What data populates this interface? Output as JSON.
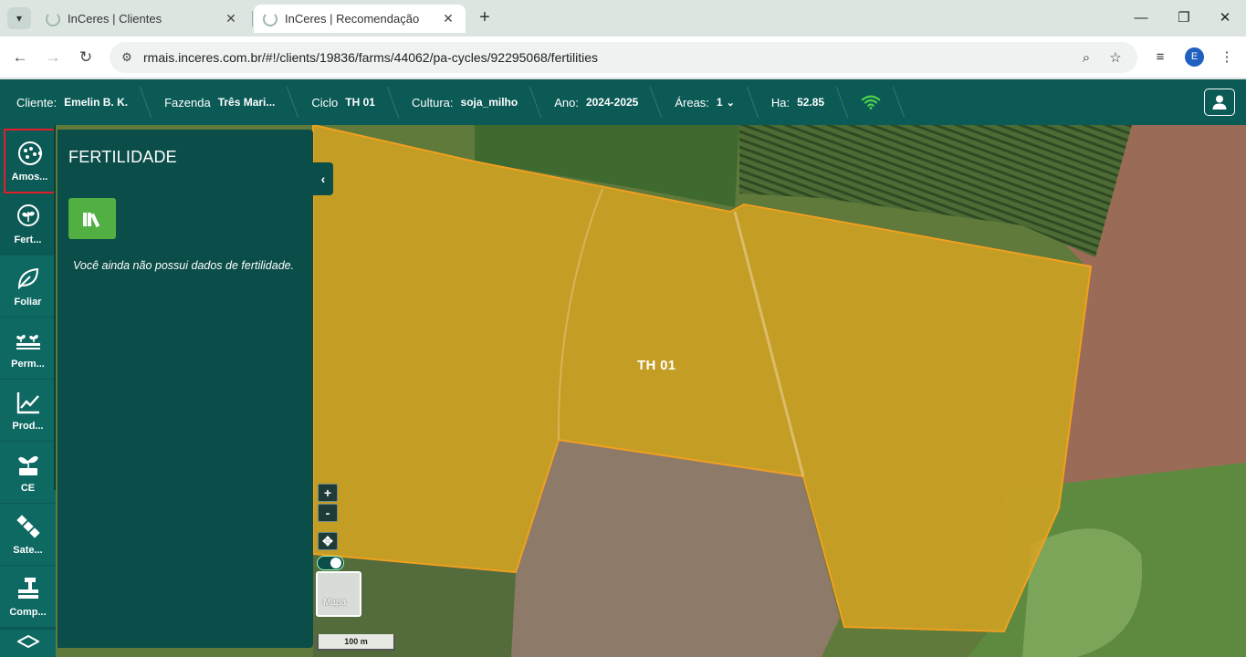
{
  "browser": {
    "tabs": [
      {
        "title": "InCeres | Clientes",
        "active": false
      },
      {
        "title": "InCeres | Recomendação",
        "active": true
      }
    ],
    "url": "rmais.inceres.com.br/#!/clients/19836/farms/44062/pa-cycles/92295068/fertilities",
    "profile_initial": "E"
  },
  "header": {
    "crumbs": [
      {
        "key": "Cliente:",
        "value": "Emelin B. K."
      },
      {
        "key": "Fazenda",
        "value": "Três Mari..."
      },
      {
        "key": "Ciclo",
        "value": "TH 01"
      },
      {
        "key": "Cultura:",
        "value": "soja_milho"
      },
      {
        "key": "Ano:",
        "value": "2024-2025"
      },
      {
        "key": "Áreas:",
        "value": "1"
      },
      {
        "key": "Ha:",
        "value": "52.85"
      }
    ],
    "accent": "#0b5a55"
  },
  "rail": {
    "items": [
      {
        "label": "Amos...",
        "icon": "sampling-icon"
      },
      {
        "label": "Fert...",
        "icon": "fertility-icon"
      },
      {
        "label": "Foliar",
        "icon": "leaf-icon"
      },
      {
        "label": "Perm...",
        "icon": "seedlings-icon"
      },
      {
        "label": "Prod...",
        "icon": "chart-line-icon"
      },
      {
        "label": "CE",
        "icon": "plant-ce-icon"
      },
      {
        "label": "Sate...",
        "icon": "satellite-icon"
      },
      {
        "label": "Comp...",
        "icon": "compaction-icon"
      }
    ]
  },
  "panel": {
    "title": "FERTILIDADE",
    "empty_message": "Você ainda não possui dados de fertilidade."
  },
  "map": {
    "field_name": "TH 01",
    "zoom_in": "+",
    "zoom_out": "-",
    "basemap_label": "Mapa",
    "scale_label": "100 m",
    "field_fill": "#d9a520",
    "field_border": "#f0a020"
  }
}
